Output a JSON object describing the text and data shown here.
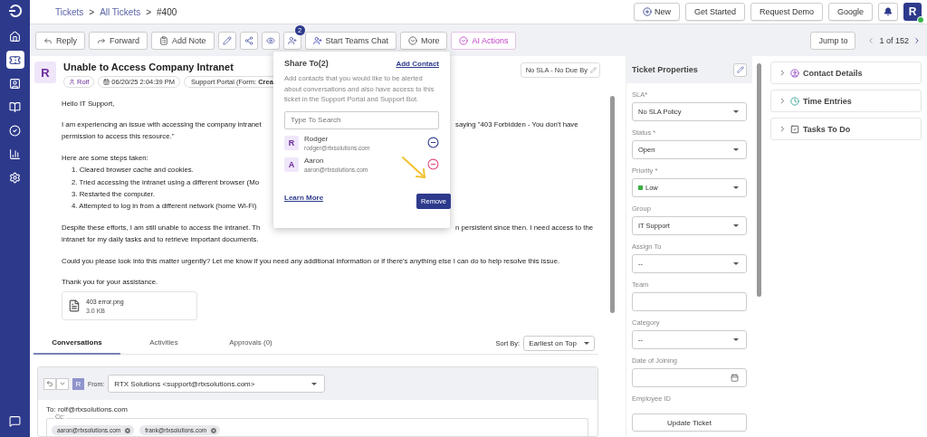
{
  "sidebar": {
    "items": [
      {
        "selected": false
      },
      {
        "selected": true
      },
      {
        "selected": false
      },
      {
        "selected": false
      },
      {
        "selected": false
      },
      {
        "selected": false
      },
      {
        "selected": false
      }
    ]
  },
  "breadcrumb": [
    "Tickets",
    ">",
    "All Tickets",
    ">",
    "#400"
  ],
  "header_buttons": [
    {
      "kind": "new",
      "label": "New"
    },
    {
      "kind": "plain",
      "label": "Get Started"
    },
    {
      "kind": "plain",
      "label": "Request Demo"
    },
    {
      "kind": "plain",
      "label": "Google"
    }
  ],
  "user_avatar": {
    "letter": "R",
    "online": true
  },
  "toolbar": {
    "actions": [
      {
        "kind": "text",
        "label": "Reply"
      },
      {
        "kind": "text",
        "label": "Forward"
      },
      {
        "kind": "text",
        "label": "Add Note"
      },
      {
        "kind": "icon"
      },
      {
        "kind": "icon"
      },
      {
        "kind": "icon"
      },
      {
        "kind": "icon",
        "badge": "2"
      },
      {
        "kind": "text",
        "label": "Start Teams Chat"
      },
      {
        "kind": "text",
        "label": "More"
      },
      {
        "kind": "accent",
        "label": "AI Actions"
      }
    ],
    "jump_to": "Jump to",
    "pager": "1 of 152"
  },
  "ticket": {
    "avatar": "R",
    "title": "Unable to Access Company Intranet",
    "requester": "Rolf",
    "date": "06/20/25 2:04:39 PM",
    "source": "Support Portal (Form: **Crea**",
    "sla": "No SLA - No Due By",
    "body": [
      {
        "kind": "para",
        "text": "Hello IT Support,"
      },
      {
        "kind": "para",
        "text": "I am experiencing an issue with accessing the company intranet",
        "right": "saying \"403 Forbidden - You don't have"
      },
      {
        "kind": "line",
        "text": "permission to access this resource.\""
      },
      {
        "kind": "para",
        "text": "Here are some steps taken:"
      },
      {
        "kind": "step",
        "text": "1. Cleared browser cache and cookies."
      },
      {
        "kind": "step",
        "text": "2. Tried accessing the intranet using a different browser (Mo"
      },
      {
        "kind": "step",
        "text": "3. Restarted the computer."
      },
      {
        "kind": "step",
        "text": "4. Attempted to log in from a different network (home Wi-Fi)"
      },
      {
        "kind": "para",
        "text": "Despite these efforts, I am still unable to access the intranet. Th",
        "right": "n persistent since then. I need access to the"
      },
      {
        "kind": "line",
        "text": "intranet for my daily tasks and to retrieve important documents."
      },
      {
        "kind": "para",
        "text": "Could you please look into this matter urgently? Let me know if you need any additional information or if there's anything else I can do to help resolve this issue."
      },
      {
        "kind": "para",
        "text": "Thank you for your assistance."
      }
    ],
    "attachment": {
      "name": "403 error.png",
      "size": "3.0 KB"
    }
  },
  "tabs": [
    {
      "label": "Conversations",
      "selected": true
    },
    {
      "label": "Activities",
      "selected": false
    },
    {
      "label": "Approvals (0)",
      "selected": false
    }
  ],
  "sort": {
    "label": "Sort By:",
    "value": "Earliest on Top"
  },
  "reply": {
    "sender_avatar": "R",
    "from_label": "From:",
    "from": "RTX Solutions <support@rtxsolutions.com>",
    "to": "To: rolf@rtxsolutions.com",
    "cc_label": "Cc:",
    "cc": [
      "aaron@rtxsolutions.com",
      "frank@rtxsolutions.com"
    ]
  },
  "share_popup": {
    "title": "Share To(2)",
    "add_link": "Add Contact",
    "description": "Add contacts that you would like to be alerted about conversations and also have access to this ticket in the Support Portal and Support Bot.",
    "search_placeholder": "Type To Search",
    "contacts": [
      {
        "avatar": "R",
        "name": "Rodger",
        "email": "rodger@rtxsolutions.com",
        "highlighted": false
      },
      {
        "avatar": "A",
        "name": "Aaron",
        "email": "aaron@rtxsolutions.com",
        "highlighted": true
      }
    ],
    "tooltip": "Remove",
    "learn_more": "Learn More"
  },
  "properties": {
    "title": "Ticket Properties",
    "fields": [
      {
        "kind": "select",
        "label": "SLA*",
        "value": "No SLA Policy"
      },
      {
        "kind": "select",
        "label": "Status *",
        "value": "Open"
      },
      {
        "kind": "select",
        "label": "Priority *",
        "value": "Low",
        "color": "#3cb043"
      },
      {
        "kind": "select",
        "label": "Group",
        "value": "IT Support"
      },
      {
        "kind": "select",
        "label": "Assign To",
        "value": "--"
      },
      {
        "kind": "input",
        "label": "Team"
      },
      {
        "kind": "select",
        "label": "Category",
        "value": "--"
      },
      {
        "kind": "date",
        "label": "Date of Joining"
      },
      {
        "kind": "label",
        "label": "Employee ID"
      }
    ],
    "update_button": "Update Ticket"
  },
  "side_sections": [
    {
      "label": "Contact Details",
      "expanded": false
    },
    {
      "label": "Time Entries",
      "expanded": false
    },
    {
      "label": "Tasks To Do",
      "expanded": false
    }
  ]
}
